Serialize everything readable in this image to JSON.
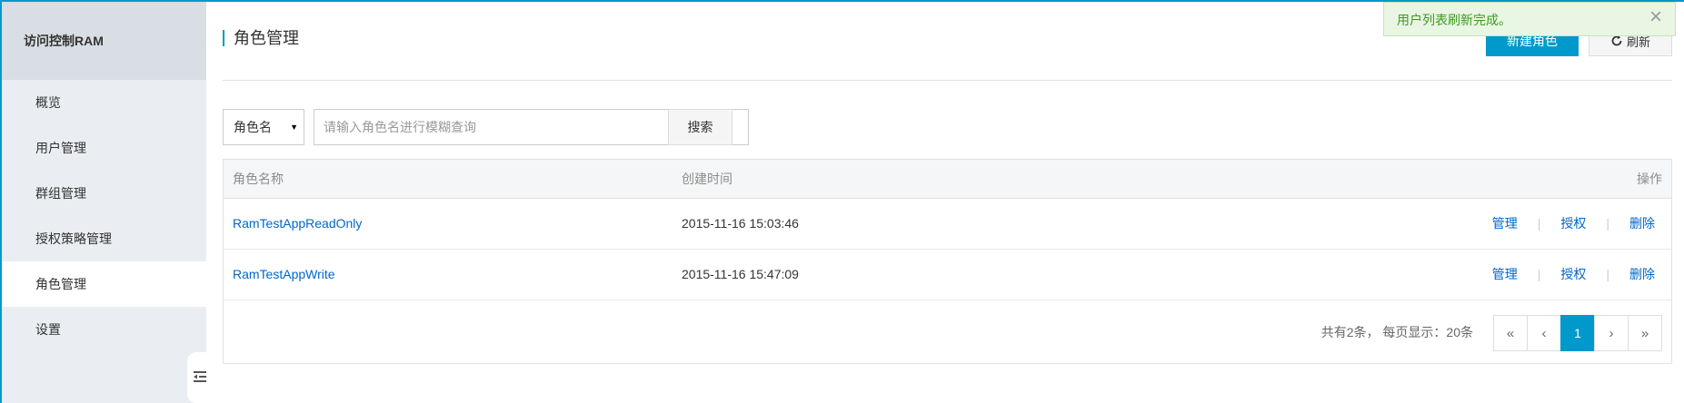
{
  "sidebar": {
    "title": "访问控制RAM",
    "items": [
      {
        "label": "概览"
      },
      {
        "label": "用户管理"
      },
      {
        "label": "群组管理"
      },
      {
        "label": "授权策略管理"
      },
      {
        "label": "角色管理"
      },
      {
        "label": "设置"
      }
    ],
    "active_index": 4
  },
  "header": {
    "title": "角色管理",
    "create_label": "新建角色",
    "refresh_label": "刷新"
  },
  "search": {
    "field_selected": "角色名",
    "placeholder": "请输入角色名进行模糊查询",
    "value": "",
    "button_label": "搜索"
  },
  "table": {
    "columns": [
      "角色名称",
      "创建时间",
      "操作"
    ],
    "rows": [
      {
        "name": "RamTestAppReadOnly",
        "created": "2015-11-16 15:03:46"
      },
      {
        "name": "RamTestAppWrite",
        "created": "2015-11-16 15:47:09"
      }
    ],
    "actions": {
      "manage": "管理",
      "authorize": "授权",
      "delete": "删除",
      "separator": "|"
    }
  },
  "pagination": {
    "summary": "共有2条， 每页显示：20条",
    "first": "«",
    "prev": "‹",
    "current_page": "1",
    "next": "›",
    "last": "»"
  },
  "toast": {
    "message": "用户列表刷新完成。",
    "close": "×"
  },
  "colors": {
    "accent": "#0099cc",
    "link": "#0066cc",
    "toast_text": "#3c9a1f",
    "toast_bg": "#e9f6e3"
  },
  "icons": [
    "refresh-icon",
    "close-icon",
    "collapse-sidebar-icon",
    "caret-down-icon"
  ]
}
